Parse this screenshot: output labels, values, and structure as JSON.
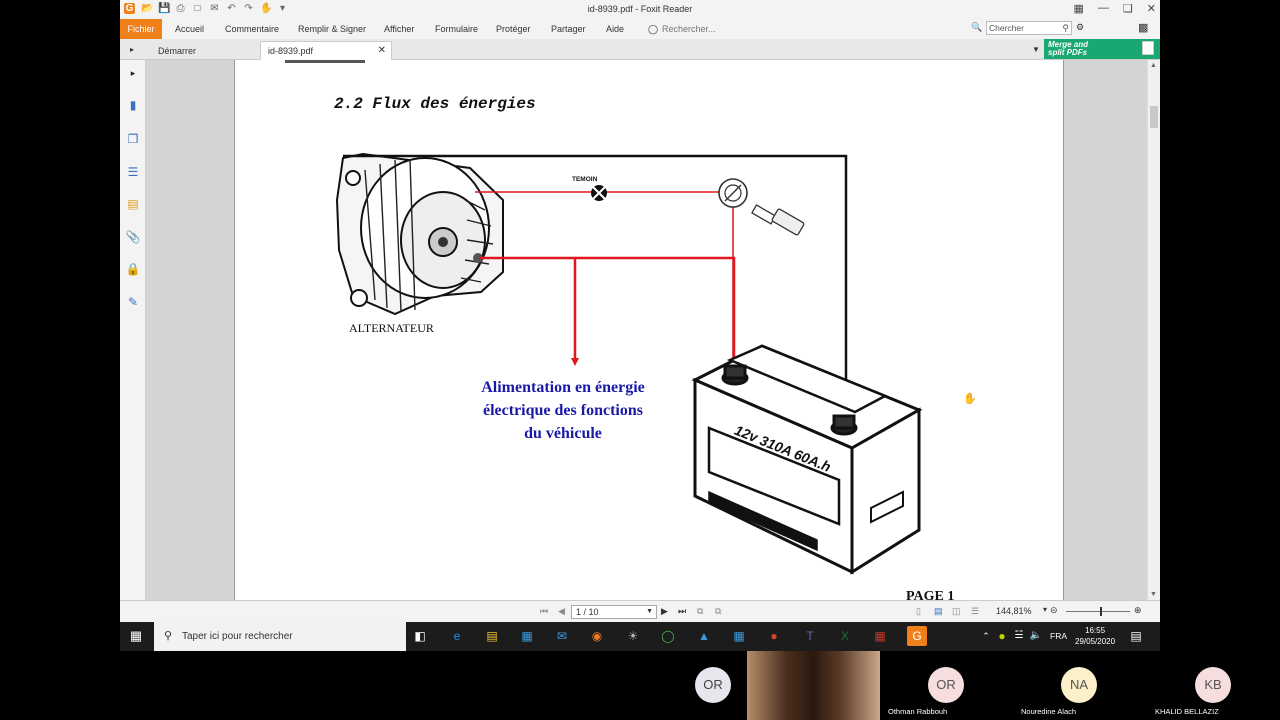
{
  "window": {
    "title": "id-8939.pdf - Foxit Reader"
  },
  "menu": {
    "fichier": "Fichier",
    "items": [
      "Accueil",
      "Commentaire",
      "Remplir & Signer",
      "Afficher",
      "Formulaire",
      "Protéger",
      "Partager",
      "Aide"
    ],
    "search_hint": "Rechercher...",
    "search_placeholder": "Chercher"
  },
  "tabs": {
    "start": "Démarrer",
    "doc": "id-8939.pdf"
  },
  "promo": {
    "line1": "Merge and",
    "line2": "split PDFs"
  },
  "document": {
    "heading": "2.2 Flux des énergies",
    "temoin_label": "TEMOIN",
    "alternator_label": "ALTERNATEUR",
    "supply_line1": "Alimentation en énergie",
    "supply_line2": "électrique des fonctions",
    "supply_line3": "du véhicule",
    "battery_label": "12v 310A 60A.h",
    "footer": "PAGE 1"
  },
  "status": {
    "page": "1 / 10",
    "zoom": "144,81%"
  },
  "taskbar": {
    "search_placeholder": "Taper ici pour rechercher",
    "lang": "FRA",
    "time": "16:55",
    "date": "29/05/2020"
  },
  "participants": [
    {
      "initials": "OR",
      "name": ""
    },
    {
      "initials": "OR",
      "name": "Othman Rabbouh"
    },
    {
      "initials": "NA",
      "name": "Nouredine Alach"
    },
    {
      "initials": "KB",
      "name": "KHALID BELLAZIZ"
    }
  ],
  "colors": {
    "accent": "#f0811a",
    "wire_red": "#e0161e",
    "text_blue": "#1a1aa6",
    "promo_green": "#19a772"
  }
}
